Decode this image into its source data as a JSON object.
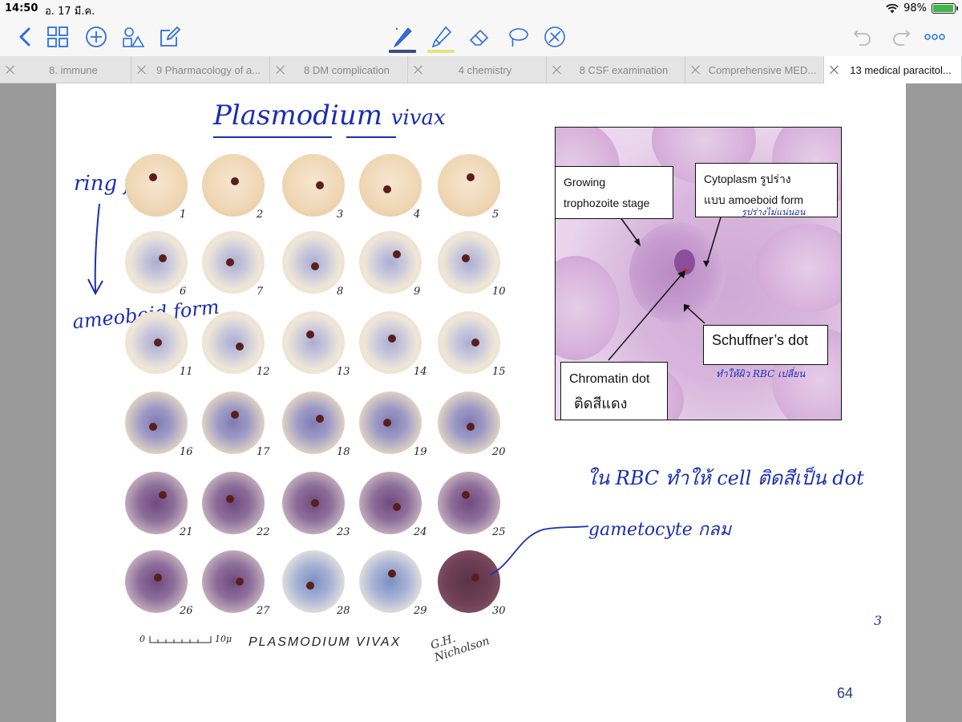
{
  "status": {
    "time": "14:50",
    "date": "อ. 17 มี.ค.",
    "battery": "98%",
    "battery_level": 0.98
  },
  "toolbar": {
    "icons": [
      "back-icon",
      "grid-icon",
      "add-icon",
      "shapes-icon",
      "edit-icon",
      "pen-icon",
      "highlighter-icon",
      "eraser-icon",
      "lasso-icon",
      "disable-icon",
      "undo-icon",
      "redo-icon",
      "more-icon"
    ],
    "pen_color": "#3d4a8c",
    "highlighter_color": "#e9e184"
  },
  "tabs": [
    {
      "label": "8. immune",
      "active": false
    },
    {
      "label": "9 Pharmacology of a...",
      "active": false
    },
    {
      "label": "8 DM complication",
      "active": false
    },
    {
      "label": "4 chemistry",
      "active": false
    },
    {
      "label": "8 CSF examination",
      "active": false
    },
    {
      "label": "Comprehensive MED...",
      "active": false
    },
    {
      "label": "13 medical paracitol...",
      "active": true
    }
  ],
  "page": {
    "title_word1": "Plasmodium",
    "title_word2": "vivax",
    "annotations": {
      "ring_form": "ring form",
      "ameboid_form": "ameoboid form",
      "rbc_note": "ใน RBC ทำให้ cell ติดสีเป็น dot",
      "gametocyte_note": "gametocyte กลม",
      "stray_mark": "3"
    },
    "plate": {
      "cell_numbers": [
        "1",
        "2",
        "3",
        "4",
        "5",
        "6",
        "7",
        "8",
        "9",
        "10",
        "11",
        "12",
        "13",
        "14",
        "15",
        "16",
        "17",
        "18",
        "19",
        "20",
        "21",
        "22",
        "23",
        "24",
        "25",
        "26",
        "27",
        "28",
        "29",
        "30"
      ],
      "caption": "PLASMODIUM VIVAX",
      "scale_start": "0",
      "scale_end": "10μ",
      "signature": "G.H. Nicholson"
    },
    "micrograph": {
      "label_growing_line1": "Growing",
      "label_growing_line2": "trophozoite stage",
      "label_cytoplasm_line1": "Cytoplasm รูปร่าง",
      "label_cytoplasm_line2": "แบบ amoeboid form",
      "note_cytoplasm_hw": "รูปร่างไม่แน่นอน",
      "label_schuffner": "Schuffner’s dot",
      "note_schuffner_hw": "ทำให้ผิว RBC เปลี่ยน",
      "label_chromatin_line1": "Chromatin dot",
      "label_chromatin_line2": "ติดสีแดง"
    },
    "page_number": "64"
  }
}
